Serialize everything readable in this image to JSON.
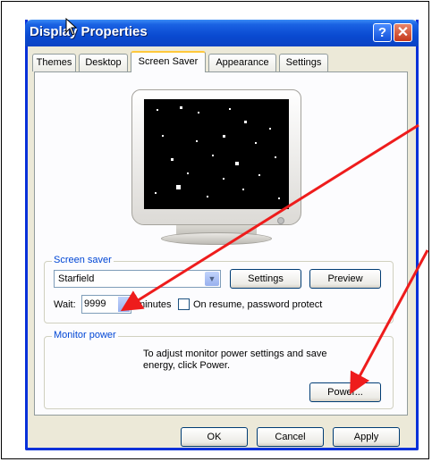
{
  "window": {
    "title": "Display Properties"
  },
  "tabs": [
    {
      "label": "Themes"
    },
    {
      "label": "Desktop"
    },
    {
      "label": "Screen Saver"
    },
    {
      "label": "Appearance"
    },
    {
      "label": "Settings"
    }
  ],
  "screen_saver": {
    "group_label": "Screen saver",
    "selected": "Starfield",
    "settings_label": "Settings",
    "preview_label": "Preview",
    "wait_label": "Wait:",
    "wait_value": "9999",
    "minutes_label": "minutes",
    "password_label": "On resume, password protect"
  },
  "monitor_power": {
    "group_label": "Monitor power",
    "description": "To adjust monitor power settings and save energy, click Power.",
    "power_label": "Power..."
  },
  "footer": {
    "ok_label": "OK",
    "cancel_label": "Cancel",
    "apply_label": "Apply"
  },
  "colors": {
    "accent_arrow": "#ee1c1c",
    "title_bar": "#0a4ad1",
    "group_label": "#0046d5"
  }
}
